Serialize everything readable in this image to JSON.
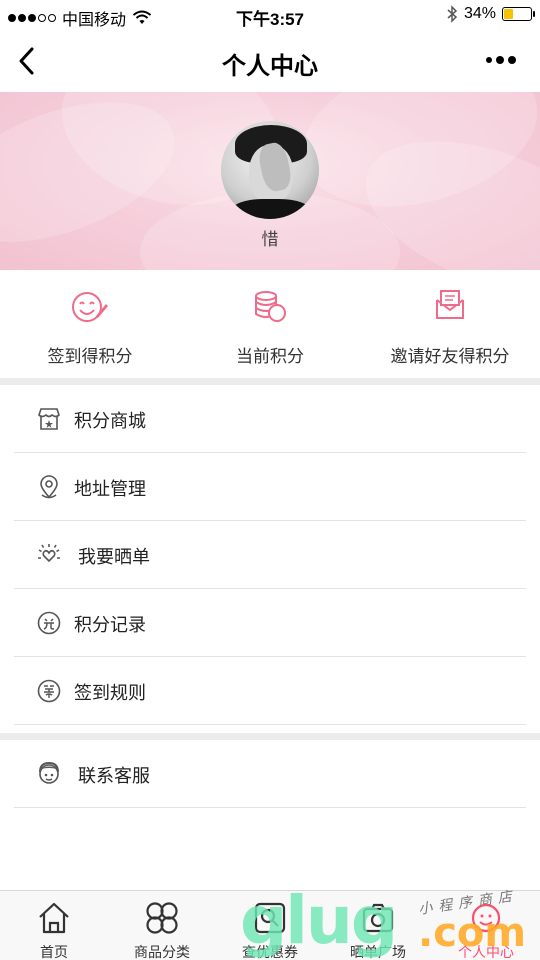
{
  "status_bar": {
    "carrier": "中国移动",
    "time": "下午3:57",
    "battery": "34%",
    "icons": [
      "signal-dots",
      "wifi-icon",
      "bluetooth-icon",
      "battery-icon"
    ]
  },
  "nav": {
    "title": "个人中心",
    "icons": [
      "back-arrow-icon",
      "more-dots-icon"
    ]
  },
  "profile": {
    "username": "惜"
  },
  "points": [
    {
      "label": "签到得积分",
      "icon": "smile-pen-icon"
    },
    {
      "label": "当前积分",
      "icon": "coins-icon"
    },
    {
      "label": "邀请好友得积分",
      "icon": "envelope-icon"
    }
  ],
  "menu": [
    {
      "label": "积分商城",
      "icon": "store-icon"
    },
    {
      "label": "地址管理",
      "icon": "location-pin-icon"
    },
    {
      "label": "我要晒单",
      "icon": "sun-heart-icon"
    },
    {
      "label": "积分记录",
      "icon": "exchange-icon"
    },
    {
      "label": "签到规则",
      "icon": "sign-rule-icon"
    }
  ],
  "service": {
    "label": "联系客服",
    "icon": "support-icon"
  },
  "tabs": [
    {
      "label": "首页",
      "icon": "home-icon"
    },
    {
      "label": "商品分类",
      "icon": "clover-icon"
    },
    {
      "label": "查优惠券",
      "icon": "search-coupon-icon"
    },
    {
      "label": "晒单广场",
      "icon": "camera-icon"
    },
    {
      "label": "个人中心",
      "icon": "user-icon",
      "active": true
    }
  ],
  "watermark": {
    "big": "glug",
    "com": ".com",
    "small": "小程序商店"
  },
  "colors": {
    "accent": "#ff4d6d",
    "icon_pink": "#f06a8a",
    "banner_pink": "#f6d0dc",
    "divider": "#ececec"
  }
}
